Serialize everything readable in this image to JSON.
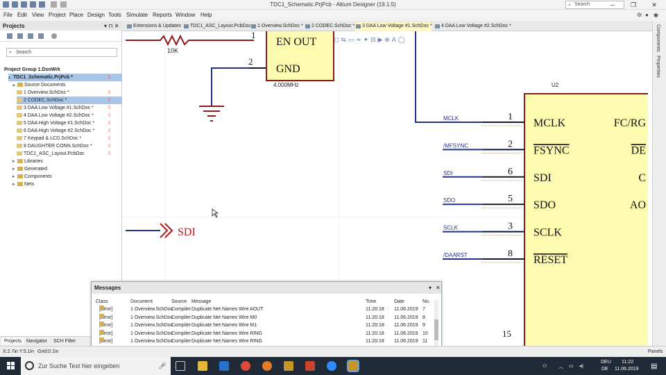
{
  "titlebar": {
    "title": "TDC1_Schematic.PrjPcb - Altium Designer (19.1.5)",
    "search_placeholder": "Search",
    "minimize": "─",
    "maximize": "❐",
    "close": "✕"
  },
  "menu": [
    "File",
    "Edit",
    "View",
    "Project",
    "Place",
    "Design",
    "Tools",
    "Simulate",
    "Reports",
    "Window",
    "Help"
  ],
  "projects_panel": {
    "title": "Projects",
    "search_placeholder": "Search",
    "tree": [
      {
        "label": "Project Group 1.DsnWrk",
        "level": 0,
        "bold": true,
        "arrow": ""
      },
      {
        "label": "TDC1_Schematic.PrjPcb *",
        "level": 1,
        "bold": true,
        "arrow": "▲",
        "selected": true,
        "mod": "▯"
      },
      {
        "label": "Source Documents",
        "level": 2,
        "arrow": "▲",
        "folder": true
      },
      {
        "label": "1 Overview.SchDoc *",
        "level": 3,
        "mod": "▯"
      },
      {
        "label": "2 CODEC.SchDoc *",
        "level": 3,
        "selected": true,
        "mod": "▯"
      },
      {
        "label": "3 DAA Low Voltage #1.SchDoc *",
        "level": 3,
        "mod": "▯"
      },
      {
        "label": "4 DAA Low Voltage #2.SchDoc *",
        "level": 3,
        "mod": "▯"
      },
      {
        "label": "5 DAA High Voltage #1.SchDoc *",
        "level": 3,
        "mod": "▯"
      },
      {
        "label": "6 DAA High Voltage #2.SchDoc *",
        "level": 3,
        "mod": "▯"
      },
      {
        "label": "7 Keypad & LCD.SchDoc *",
        "level": 3,
        "mod": "▯"
      },
      {
        "label": "8 DAUGHTER CONN.SchDoc *",
        "level": 3,
        "mod": "▯"
      },
      {
        "label": "TDC1_ASC_Layout.PcbDoc",
        "level": 3,
        "mod": "▯"
      },
      {
        "label": "Libraries",
        "level": 2,
        "arrow": "▶",
        "folder": true
      },
      {
        "label": "Generated",
        "level": 2,
        "arrow": "▶",
        "folder": true
      },
      {
        "label": "Components",
        "level": 2,
        "arrow": "▶",
        "folder": true
      },
      {
        "label": "Nets",
        "level": 2,
        "arrow": "▶",
        "folder": true
      }
    ],
    "tabs": [
      "Projects",
      "Navigator",
      "SCH Filter"
    ]
  },
  "doc_tabs": [
    {
      "label": "Extensions & Updates"
    },
    {
      "label": "TDC1_ASC_Layout.PcbDoc"
    },
    {
      "label": "1 Overview.SchDoc *"
    },
    {
      "label": "2 CODEC.SchDoc *"
    },
    {
      "label": "3 DAA Low Voltage #1.SchDoc *",
      "active": true
    },
    {
      "label": "4 DAA Low Voltage #2.SchDoc *"
    }
  ],
  "schematic": {
    "resistor_label": "10K",
    "pin_en": "1",
    "pin_gnd": "2",
    "en_label": "EN   OUT",
    "gnd_label": "GND",
    "osc_label": "4.000MHz",
    "ic_ref": "U2",
    "port_label": "SDI",
    "pins": [
      {
        "net": "MCLK",
        "num": "1",
        "name": "MCLK",
        "overline": false,
        "right": "FC/RG"
      },
      {
        "net": "/MFSYNC",
        "num": "2",
        "name": "FSYNC",
        "overline": true,
        "right": "DE"
      },
      {
        "net": "SDI",
        "num": "6",
        "name": "SDI",
        "overline": false,
        "right": "C"
      },
      {
        "net": "SDO",
        "num": "5",
        "name": "SDO",
        "overline": false,
        "right": "AO"
      },
      {
        "net": "SCLK",
        "num": "3",
        "name": "SCLK",
        "overline": false,
        "right": ""
      },
      {
        "net": "/DAARST",
        "num": "8",
        "name": "RESET",
        "overline": true,
        "right": ""
      }
    ],
    "bottom_pin": "15"
  },
  "right_panel": [
    "Components",
    "Properties"
  ],
  "messages": {
    "title": "Messages",
    "columns": [
      "Class",
      "Document",
      "Source",
      "Message",
      "Time",
      "Date",
      "No."
    ],
    "rows": [
      {
        "class": "[Error]",
        "doc": "1 Overview.SchDoc",
        "src": "Compiler",
        "msg": "Duplicate Net Names Wire AOUT",
        "time": "11:20:18",
        "date": "11.06.2019",
        "no": "7"
      },
      {
        "class": "[Error]",
        "doc": "1 Overview.SchDoc",
        "src": "Compiler",
        "msg": "Duplicate Net Names Wire M0",
        "time": "11:20:18",
        "date": "11.06.2019",
        "no": "8"
      },
      {
        "class": "[Error]",
        "doc": "1 Overview.SchDoc",
        "src": "Compiler",
        "msg": "Duplicate Net Names Wire M1",
        "time": "11:20:18",
        "date": "11.06.2019",
        "no": "9"
      },
      {
        "class": "[Error]",
        "doc": "1 Overview.SchDoc",
        "src": "Compiler",
        "msg": "Duplicate Net Names Wire RING",
        "time": "11:20:18",
        "date": "11.06.2019",
        "no": "10"
      },
      {
        "class": "[Error]",
        "doc": "1 Overview.SchDoc",
        "src": "Compiler",
        "msg": "Duplicate Net Names Wire RING",
        "time": "11:20:18",
        "date": "11.06.2019",
        "no": "11"
      },
      {
        "class": "[Error]",
        "doc": "1 Overview.SchDoc",
        "src": "Compiler",
        "msg": "Duplicate Net Names Wire SCLK",
        "time": "11:20:18",
        "date": "11.06.2019",
        "no": "12"
      }
    ]
  },
  "status": {
    "coords": "X:2.7in Y:5.1in",
    "grid": "Grid:0.1in",
    "panels": "Panels"
  },
  "taskbar": {
    "search_placeholder": "Zur Suche Text hier eingeben",
    "lang1": "DEU",
    "lang2": "DE",
    "time": "11:22",
    "date": "11.06.2019"
  }
}
